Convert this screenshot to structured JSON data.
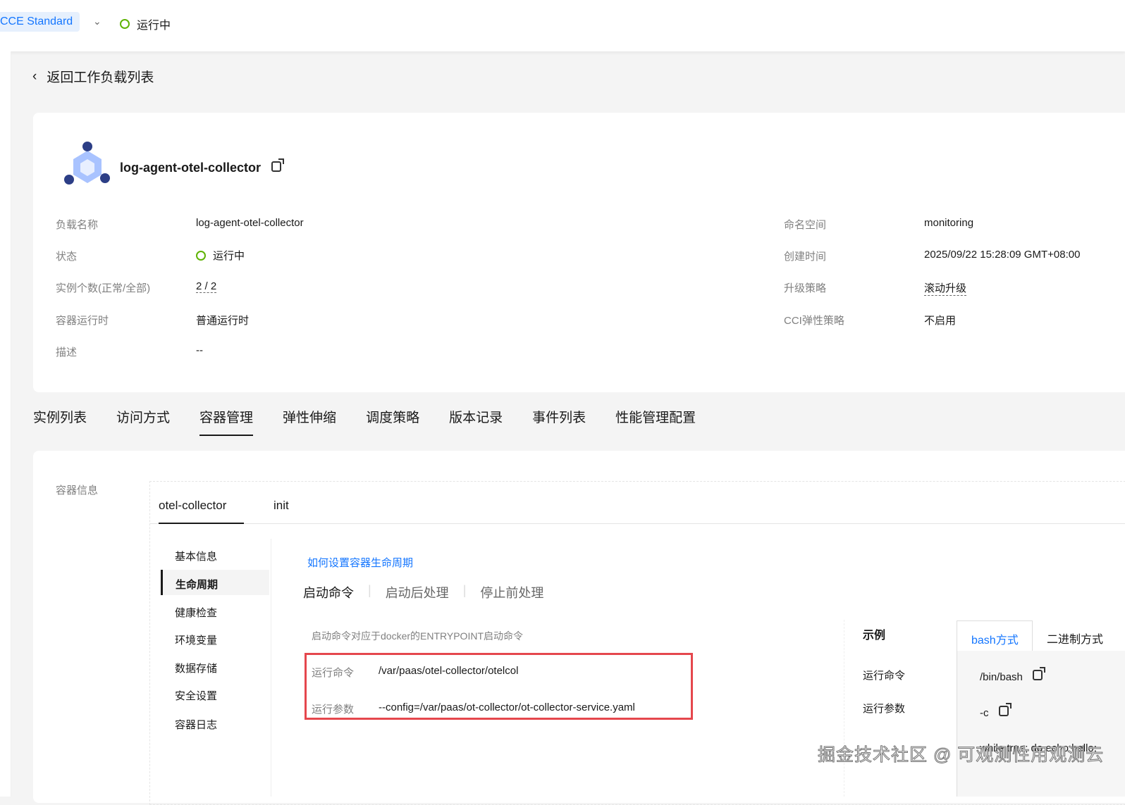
{
  "topbar": {
    "badge": "CCE Standard",
    "status": "运行中"
  },
  "back_label": "返回工作负载列表",
  "workload": {
    "title": "log-agent-otel-collector",
    "left": [
      {
        "label": "负载名称",
        "value": "log-agent-otel-collector"
      },
      {
        "label": "状态",
        "value": "运行中"
      },
      {
        "label": "实例个数(正常/全部)",
        "value": "2 / 2"
      },
      {
        "label": "容器运行时",
        "value": "普通运行时"
      },
      {
        "label": "描述",
        "value": "--"
      }
    ],
    "right": [
      {
        "label": "命名空间",
        "value": "monitoring"
      },
      {
        "label": "创建时间",
        "value": "2025/09/22 15:28:09 GMT+08:00"
      },
      {
        "label": "升级策略",
        "value": "滚动升级"
      },
      {
        "label": "CCI弹性策略",
        "value": "不启用"
      }
    ]
  },
  "tabs": [
    "实例列表",
    "访问方式",
    "容器管理",
    "弹性伸缩",
    "调度策略",
    "版本记录",
    "事件列表",
    "性能管理配置"
  ],
  "container": {
    "section_label": "容器信息",
    "containers": [
      "otel-collector",
      "init"
    ],
    "side": [
      "基本信息",
      "生命周期",
      "健康检查",
      "环境变量",
      "数据存储",
      "安全设置",
      "容器日志"
    ],
    "help_link": "如何设置容器生命周期",
    "lifecycle_tabs": [
      "启动命令",
      "启动后处理",
      "停止前处理"
    ],
    "hint": "启动命令对应于docker的ENTRYPOINT启动命令",
    "command_label": "运行命令",
    "command": "/var/paas/otel-collector/otelcol",
    "args_label": "运行参数",
    "args": "--config=/var/paas/ot-collector/ot-collector-service.yaml",
    "example": {
      "title": "示例",
      "tabs": [
        "bash方式",
        "二进制方式"
      ],
      "cmd_label": "运行命令",
      "cmd": "/bin/bash",
      "args_label": "运行参数",
      "arg1": "-c",
      "arg2": "while true; do echo hello;"
    }
  },
  "watermark": "掘金技术社区 @ 可观测性用观测云"
}
